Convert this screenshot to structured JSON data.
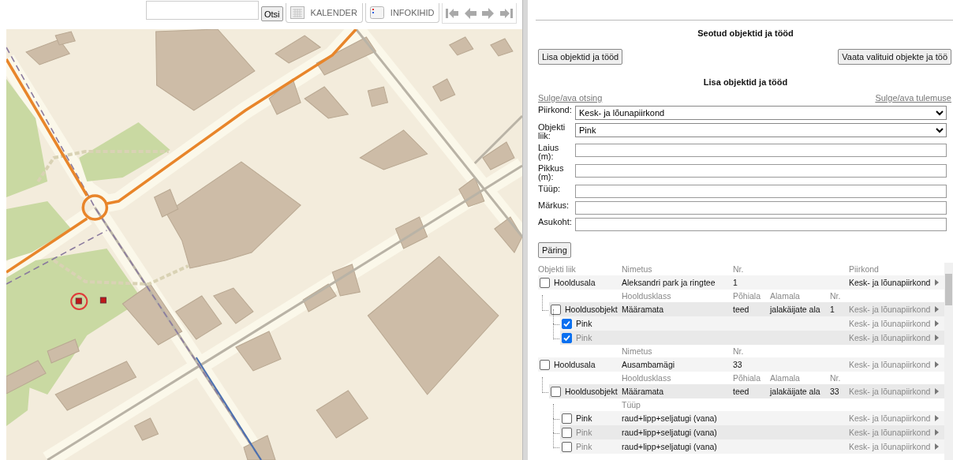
{
  "toolbar": {
    "search_button": "Otsi",
    "tabs": [
      {
        "kind": "calendar",
        "label": "KALENDER"
      },
      {
        "kind": "layers",
        "label": "INFOKIHID"
      }
    ]
  },
  "panel": {
    "title": "Seotud objektid ja tööd",
    "buttons": [
      "Lisa objektid ja tööd",
      "Vaata valituid objekte ja töö"
    ],
    "subtitle": "Lisa objektid ja tööd",
    "links": [
      "Sulge/ava otsing",
      "Sulge/ava tulemuse"
    ],
    "form": [
      {
        "kind": "select",
        "label": "Piirkond:",
        "value": "Kesk- ja lõunapiirkond"
      },
      {
        "kind": "select",
        "label": "Objekti liik:",
        "value": "Pink"
      },
      {
        "kind": "text",
        "label": "Laius (m):"
      },
      {
        "kind": "text",
        "label": "Pikkus (m):"
      },
      {
        "kind": "text",
        "label": "Tüüp:"
      },
      {
        "kind": "text",
        "label": "Märkus:"
      },
      {
        "kind": "text",
        "label": "Asukoht:"
      }
    ],
    "query_button": "Päring",
    "results": {
      "columns": [
        "Objekti liik",
        "Nimetus",
        "Nr.",
        "Piirkond"
      ],
      "items": [
        {
          "type": "Hooldusala",
          "checked": false,
          "label_muted": false,
          "cells": [
            "Aleksandri park ja ringtee",
            "1"
          ],
          "region": "Kesk- ja lõunapiirkond",
          "region_muted": false,
          "children": [
            {
              "labels": [
                "Hooldusklass",
                "Põhiala",
                "Alamala",
                "Nr."
              ],
              "type": "Hooldusobjekt",
              "checked": false,
              "label_muted": false,
              "cells": [
                "Määramata",
                "teed",
                "jalakäijate ala",
                "1"
              ],
              "region": "Kesk- ja lõunapiirkond",
              "region_muted": true,
              "children": [
                {
                  "type": "Pink",
                  "checked": true,
                  "label_muted": false,
                  "region": "Kesk- ja lõunapiirkond",
                  "region_muted": true
                },
                {
                  "type": "Pink",
                  "checked": true,
                  "label_muted": true,
                  "region": "Kesk- ja lõunapiirkond",
                  "region_muted": true
                }
              ]
            }
          ]
        },
        {
          "labels": [
            "Nimetus",
            "Nr."
          ],
          "type": "Hooldusala",
          "checked": false,
          "label_muted": false,
          "cells": [
            "Ausambamägi",
            "33"
          ],
          "region": "Kesk- ja lõunapiirkond",
          "region_muted": true,
          "children": [
            {
              "labels": [
                "Hooldusklass",
                "Põhiala",
                "Alamala",
                "Nr."
              ],
              "type": "Hooldusobjekt",
              "checked": false,
              "label_muted": false,
              "cells": [
                "Määramata",
                "teed",
                "jalakäijate ala",
                "33"
              ],
              "region": "Kesk- ja lõunapiirkond",
              "region_muted": true,
              "children": [
                {
                  "labels": [
                    "Tüüp"
                  ],
                  "type": "Pink",
                  "checked": false,
                  "label_muted": false,
                  "cells": [
                    "raud+lipp+seljatugi (vana)"
                  ],
                  "region": "Kesk- ja lõunapiirkond",
                  "region_muted": true
                },
                {
                  "type": "Pink",
                  "checked": false,
                  "label_muted": true,
                  "cells": [
                    "raud+lipp+seljatugi (vana)"
                  ],
                  "region": "Kesk- ja lõunapiirkond",
                  "region_muted": true
                },
                {
                  "type": "Pink",
                  "checked": false,
                  "label_muted": true,
                  "cells": [
                    "raud+lipp+seljatugi (vana)"
                  ],
                  "region": "Kesk- ja lõunapiirkond",
                  "region_muted": true
                }
              ]
            }
          ]
        }
      ]
    }
  }
}
